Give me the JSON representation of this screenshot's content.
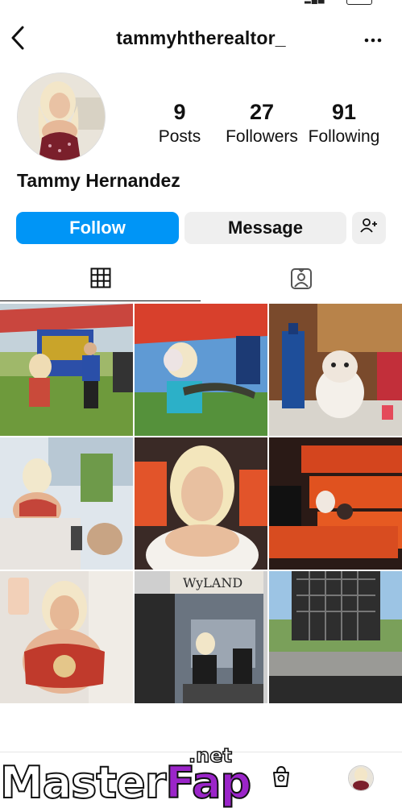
{
  "profile": {
    "username": "tammyhtherealtor_",
    "full_name": "Tammy Hernandez",
    "stats": {
      "posts_count": "9",
      "posts_label": "Posts",
      "followers_count": "27",
      "followers_label": "Followers",
      "following_count": "91",
      "following_label": "Following"
    }
  },
  "actions": {
    "follow_label": "Follow",
    "message_label": "Message"
  },
  "colors": {
    "accent": "#0095f6",
    "secondary_button": "#efefef"
  },
  "watermark": {
    "text_main": "Master",
    "text_accent": "Fap",
    "text_suffix": ".net"
  },
  "icons": [
    "back-icon",
    "more-icon",
    "suggest-person-icon",
    "grid-icon",
    "tagged-icon",
    "shopping-bag-icon"
  ]
}
